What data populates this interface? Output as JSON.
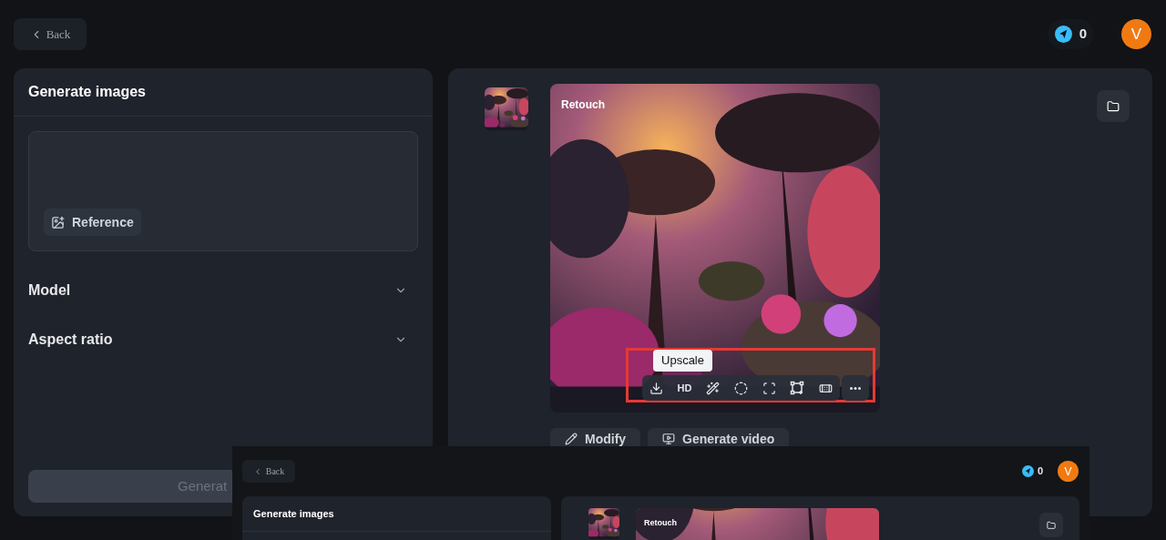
{
  "back_button": {
    "label": "Back"
  },
  "credits": {
    "count": "0"
  },
  "avatar": {
    "initial": "V"
  },
  "generate_panel": {
    "title": "Generate images",
    "reference_button": "Reference",
    "settings": [
      {
        "label": "Model",
        "expanded": false
      },
      {
        "label": "Aspect ratio",
        "expanded": false
      }
    ],
    "generate_button": "Generat"
  },
  "result": {
    "image_label": "Retouch",
    "tooltip": "Upscale",
    "hd_label": "HD",
    "highlight": true,
    "actions": [
      {
        "kind": "modify",
        "label": "Modify"
      },
      {
        "kind": "video",
        "label": "Generate video"
      }
    ]
  },
  "inset_window": {
    "back_button": "Back",
    "credits": "0",
    "avatar": "V",
    "panel_title": "Generate images",
    "image_label": "Retouch"
  }
}
